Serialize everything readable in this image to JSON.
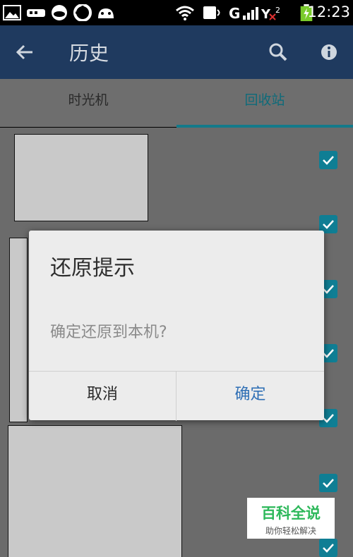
{
  "status_bar": {
    "time": "12:23",
    "icons": [
      "gallery-icon",
      "usb-icon",
      "cloud-icon",
      "app-icon",
      "android-icon",
      "wifi-icon",
      "call-icon",
      "signal-icon",
      "battery-icon"
    ]
  },
  "app_bar": {
    "title": "历史",
    "colors": {
      "background": "#1f3a5f"
    }
  },
  "tabs": [
    {
      "label": "时光机",
      "active": false
    },
    {
      "label": "回收站",
      "active": true
    }
  ],
  "dialog": {
    "title": "还原提示",
    "message": "确定还原到本机?",
    "cancel_label": "取消",
    "ok_label": "确定"
  },
  "watermark": {
    "main": "百科全说",
    "sub": "助你轻松解决"
  }
}
